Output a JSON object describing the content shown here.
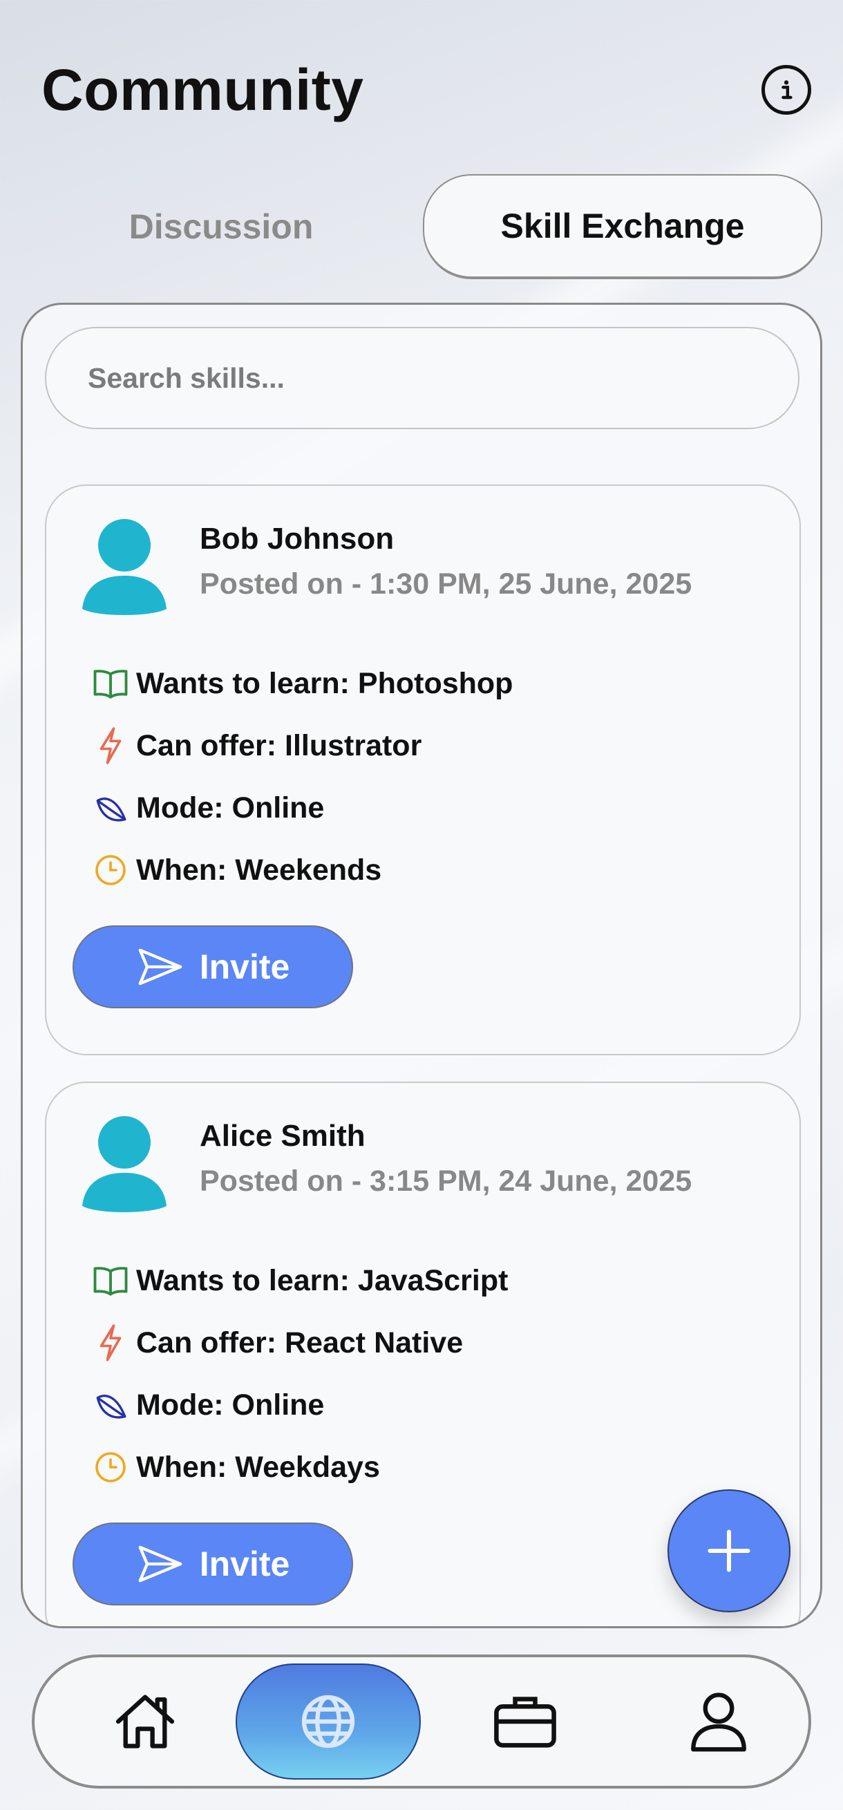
{
  "header": {
    "title": "Community"
  },
  "tabs": [
    {
      "label": "Discussion",
      "active": false
    },
    {
      "label": "Skill Exchange",
      "active": true
    }
  ],
  "search": {
    "placeholder": "Search skills..."
  },
  "posts": [
    {
      "name": "Bob Johnson",
      "posted": "Posted on - 1:30 PM, 25 June, 2025",
      "wants": "Wants to learn: Photoshop",
      "offer": "Can offer: Illustrator",
      "mode": "Mode: Online",
      "when": "When: Weekends",
      "invite_label": "Invite"
    },
    {
      "name": "Alice Smith",
      "posted": "Posted on - 3:15 PM, 24 June, 2025",
      "wants": "Wants to learn: JavaScript",
      "offer": "Can offer: React Native",
      "mode": "Mode: Online",
      "when": "When: Weekdays",
      "invite_label": "Invite"
    }
  ],
  "icons": {
    "info": "info-icon",
    "wants": "book-open-icon",
    "offer": "zap-icon",
    "mode": "leaf-icon",
    "when": "clock-icon",
    "invite": "send-icon",
    "fab": "plus-icon",
    "nav": [
      "home-icon",
      "globe-icon",
      "briefcase-icon",
      "user-icon"
    ]
  },
  "colors": {
    "accent": "#5b86f5",
    "avatar": "#1fb5cf",
    "book": "#2e8b3e",
    "zap": "#e86a4f",
    "leaf": "#2630a8",
    "clock": "#f0a81f"
  },
  "bottom_nav": {
    "active_index": 1
  }
}
